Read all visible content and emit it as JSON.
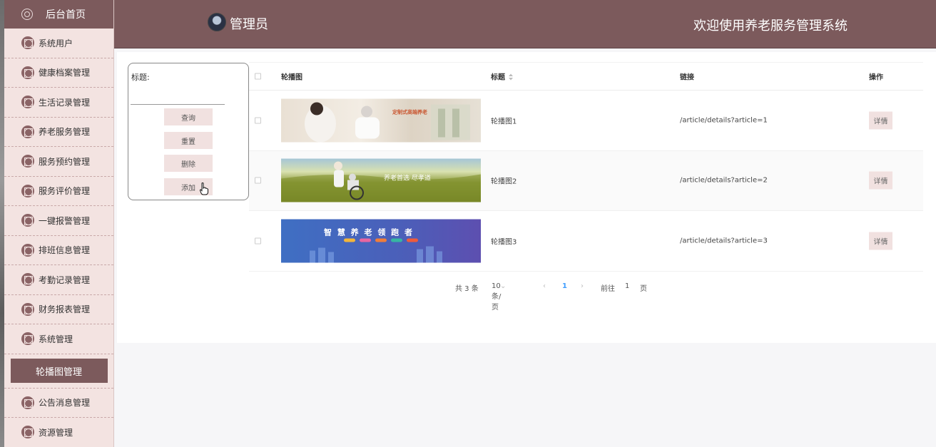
{
  "sidebar": {
    "home_label": "后台首页",
    "items": [
      {
        "label": "系统用户"
      },
      {
        "label": "健康档案管理"
      },
      {
        "label": "生活记录管理"
      },
      {
        "label": "养老服务管理"
      },
      {
        "label": "服务预约管理"
      },
      {
        "label": "服务评价管理"
      },
      {
        "label": "一键报警管理"
      },
      {
        "label": "排班信息管理"
      },
      {
        "label": "考勤记录管理"
      },
      {
        "label": "财务报表管理"
      },
      {
        "label": "系统管理"
      }
    ],
    "active_label": "轮播图管理",
    "after_items": [
      {
        "label": "公告消息管理"
      },
      {
        "label": "资源管理"
      }
    ]
  },
  "header": {
    "admin_name": "管理员",
    "welcome": "欢迎使用养老服务管理系统"
  },
  "search": {
    "label": "标题:",
    "value": "",
    "buttons": {
      "query": "查询",
      "reset": "重置",
      "delete": "删除",
      "add": "添加"
    }
  },
  "table": {
    "headers": {
      "banner": "轮播图",
      "title": "标题",
      "link": "链接",
      "action": "操作"
    },
    "rows": [
      {
        "title": "轮播图1",
        "link": "/article/details?article=1",
        "action": "详情",
        "banner_text": "定制式高端养老"
      },
      {
        "title": "轮播图2",
        "link": "/article/details?article=2",
        "action": "详情",
        "banner_text": "养老首选 尽孝道"
      },
      {
        "title": "轮播图3",
        "link": "/article/details?article=3",
        "action": "详情",
        "banner_text": "智 慧 养 老 领 跑 者"
      }
    ]
  },
  "pagination": {
    "total": "共 3 条",
    "page_size": "10条/页",
    "current_page": "1",
    "goto_prefix": "前往",
    "goto_value": "1",
    "goto_suffix": "页"
  },
  "colors": {
    "brand": "#7c5a5c",
    "sidebar_bg": "#f3e3e1",
    "button_bg": "#f1e1e0",
    "page_active": "#409eff"
  }
}
